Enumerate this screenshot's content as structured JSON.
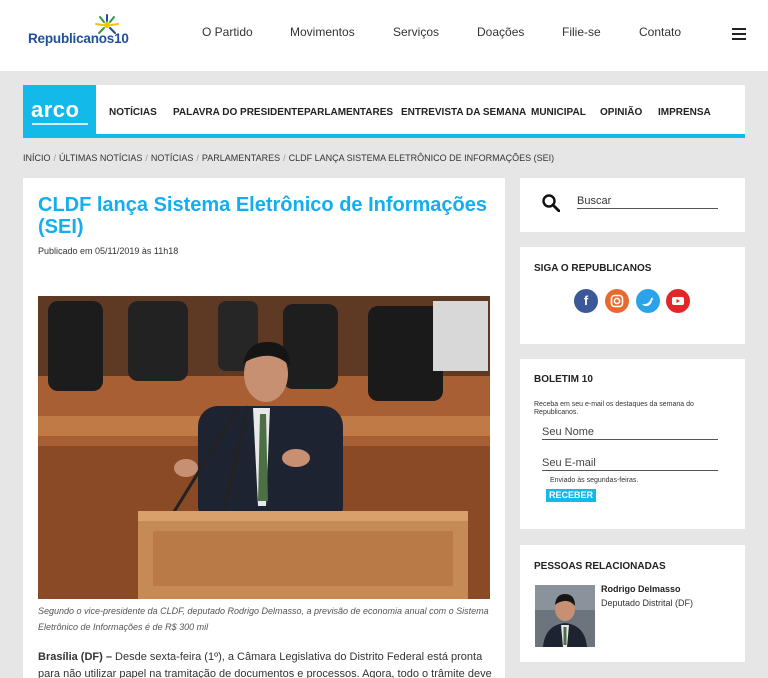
{
  "header": {
    "logo_text": "Republicanos",
    "logo_number": "10",
    "nav": [
      "O Partido",
      "Movimentos",
      "Serviços",
      "Doações",
      "Filie-se",
      "Contato"
    ]
  },
  "arco": {
    "logo_text": "arco",
    "nav": [
      "NOTÍCIAS",
      "PALAVRA DO PRESIDENTE",
      "PARLAMENTARES",
      "ENTREVISTA DA SEMANA",
      "MUNICIPAL",
      "OPINIÃO",
      "IMPRENSA"
    ]
  },
  "breadcrumb": [
    "INÍCIO",
    "ÚLTIMAS NOTÍCIAS",
    "NOTÍCIAS",
    "PARLAMENTARES",
    "CLDF LANÇA SISTEMA ELETRÔNICO DE INFORMAÇÕES (SEI)"
  ],
  "article": {
    "title": "CLDF lança Sistema Eletrônico de Informações (SEI)",
    "published": "Publicado em 05/11/2019 às 11h18",
    "caption": "Segundo o vice-presidente da CLDF, deputado Rodrigo Delmasso, a previsão de economia anual com o Sistema Eletrônico de Informações é de R$ 300 mil",
    "lead_bold": "Brasília (DF) –",
    "lead_text": " Desde sexta-feira (1º), a Câmara Legislativa do Distrito Federal está pronta para não utilizar papel na tramitação de documentos e processos. Agora, todo o trâmite deve"
  },
  "sidebar": {
    "search_placeholder": "Buscar",
    "social_title": "SIGA O REPUBLICANOS",
    "social_icons": [
      "facebook-icon",
      "instagram-icon",
      "twitter-icon",
      "youtube-icon"
    ],
    "newsletter": {
      "title": "BOLETIM 10",
      "description": "Receba em seu e-mail os destaques da semana do Republicanos.",
      "name_placeholder": "Seu Nome",
      "email_placeholder": "Seu E-mail",
      "note": "Enviado às segundas-feiras.",
      "button": "RECEBER"
    },
    "people": {
      "title": "PESSOAS RELACIONADAS",
      "name": "Rodrigo Delmasso",
      "role": "Deputado Distrital (DF)"
    }
  },
  "colors": {
    "accent": "#13b9e8",
    "title_blue": "#13aef0",
    "logo_blue": "#1f4e9c"
  }
}
